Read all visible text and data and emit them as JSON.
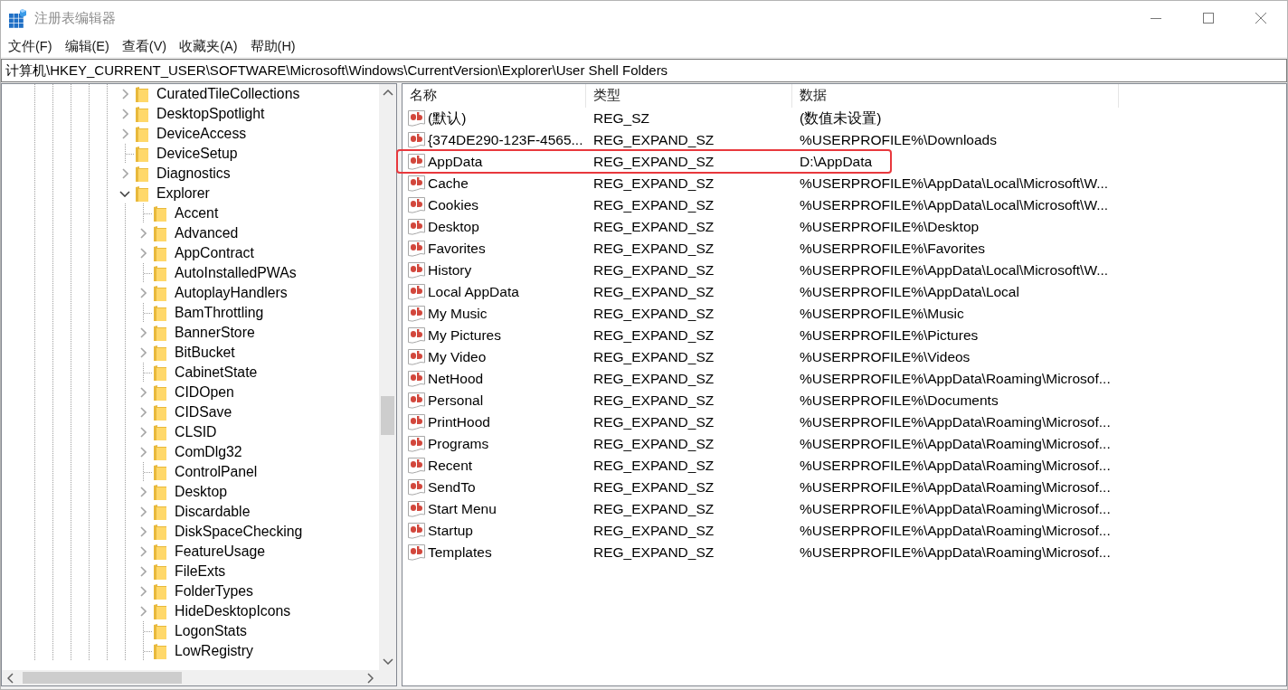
{
  "window": {
    "title": "注册表编辑器"
  },
  "menu": [
    "文件(F)",
    "编辑(E)",
    "查看(V)",
    "收藏夹(A)",
    "帮助(H)"
  ],
  "address_bar": {
    "value": "计算机\\HKEY_CURRENT_USER\\SOFTWARE\\Microsoft\\Windows\\CurrentVersion\\Explorer\\User Shell Folders"
  },
  "tree": {
    "items": [
      {
        "label": "CuratedTileCollections",
        "expandable": true,
        "expanded": false
      },
      {
        "label": "DesktopSpotlight",
        "expandable": true,
        "expanded": false
      },
      {
        "label": "DeviceAccess",
        "expandable": true,
        "expanded": false
      },
      {
        "label": "DeviceSetup",
        "expandable": false
      },
      {
        "label": "Diagnostics",
        "expandable": true,
        "expanded": false
      },
      {
        "label": "Explorer",
        "expandable": true,
        "expanded": true,
        "children": [
          {
            "label": "Accent",
            "expandable": false
          },
          {
            "label": "Advanced",
            "expandable": true,
            "expanded": false
          },
          {
            "label": "AppContract",
            "expandable": true,
            "expanded": false
          },
          {
            "label": "AutoInstalledPWAs",
            "expandable": false
          },
          {
            "label": "AutoplayHandlers",
            "expandable": true,
            "expanded": false
          },
          {
            "label": "BamThrottling",
            "expandable": false
          },
          {
            "label": "BannerStore",
            "expandable": true,
            "expanded": false
          },
          {
            "label": "BitBucket",
            "expandable": true,
            "expanded": false
          },
          {
            "label": "CabinetState",
            "expandable": false
          },
          {
            "label": "CIDOpen",
            "expandable": true,
            "expanded": false
          },
          {
            "label": "CIDSave",
            "expandable": true,
            "expanded": false
          },
          {
            "label": "CLSID",
            "expandable": true,
            "expanded": false
          },
          {
            "label": "ComDlg32",
            "expandable": true,
            "expanded": false
          },
          {
            "label": "ControlPanel",
            "expandable": false
          },
          {
            "label": "Desktop",
            "expandable": true,
            "expanded": false
          },
          {
            "label": "Discardable",
            "expandable": true,
            "expanded": false
          },
          {
            "label": "DiskSpaceChecking",
            "expandable": true,
            "expanded": false
          },
          {
            "label": "FeatureUsage",
            "expandable": true,
            "expanded": false
          },
          {
            "label": "FileExts",
            "expandable": true,
            "expanded": false
          },
          {
            "label": "FolderTypes",
            "expandable": true,
            "expanded": false
          },
          {
            "label": "HideDesktopIcons",
            "expandable": true,
            "expanded": false
          },
          {
            "label": "LogonStats",
            "expandable": false
          },
          {
            "label": "LowRegistry",
            "expandable": false
          }
        ]
      }
    ]
  },
  "values": {
    "columns": [
      "名称",
      "类型",
      "数据"
    ],
    "rows": [
      {
        "name": "(默认)",
        "type": "REG_SZ",
        "data": "(数值未设置)",
        "highlighted": false
      },
      {
        "name": "{374DE290-123F-4565...",
        "type": "REG_EXPAND_SZ",
        "data": "%USERPROFILE%\\Downloads",
        "highlighted": false
      },
      {
        "name": "AppData",
        "type": "REG_EXPAND_SZ",
        "data": "D:\\AppData",
        "highlighted": true
      },
      {
        "name": "Cache",
        "type": "REG_EXPAND_SZ",
        "data": "%USERPROFILE%\\AppData\\Local\\Microsoft\\W...",
        "highlighted": false
      },
      {
        "name": "Cookies",
        "type": "REG_EXPAND_SZ",
        "data": "%USERPROFILE%\\AppData\\Local\\Microsoft\\W...",
        "highlighted": false
      },
      {
        "name": "Desktop",
        "type": "REG_EXPAND_SZ",
        "data": "%USERPROFILE%\\Desktop",
        "highlighted": false
      },
      {
        "name": "Favorites",
        "type": "REG_EXPAND_SZ",
        "data": "%USERPROFILE%\\Favorites",
        "highlighted": false
      },
      {
        "name": "History",
        "type": "REG_EXPAND_SZ",
        "data": "%USERPROFILE%\\AppData\\Local\\Microsoft\\W...",
        "highlighted": false
      },
      {
        "name": "Local AppData",
        "type": "REG_EXPAND_SZ",
        "data": "%USERPROFILE%\\AppData\\Local",
        "highlighted": false
      },
      {
        "name": "My Music",
        "type": "REG_EXPAND_SZ",
        "data": "%USERPROFILE%\\Music",
        "highlighted": false
      },
      {
        "name": "My Pictures",
        "type": "REG_EXPAND_SZ",
        "data": "%USERPROFILE%\\Pictures",
        "highlighted": false
      },
      {
        "name": "My Video",
        "type": "REG_EXPAND_SZ",
        "data": "%USERPROFILE%\\Videos",
        "highlighted": false
      },
      {
        "name": "NetHood",
        "type": "REG_EXPAND_SZ",
        "data": "%USERPROFILE%\\AppData\\Roaming\\Microsof...",
        "highlighted": false
      },
      {
        "name": "Personal",
        "type": "REG_EXPAND_SZ",
        "data": "%USERPROFILE%\\Documents",
        "highlighted": false
      },
      {
        "name": "PrintHood",
        "type": "REG_EXPAND_SZ",
        "data": "%USERPROFILE%\\AppData\\Roaming\\Microsof...",
        "highlighted": false
      },
      {
        "name": "Programs",
        "type": "REG_EXPAND_SZ",
        "data": "%USERPROFILE%\\AppData\\Roaming\\Microsof...",
        "highlighted": false
      },
      {
        "name": "Recent",
        "type": "REG_EXPAND_SZ",
        "data": "%USERPROFILE%\\AppData\\Roaming\\Microsof...",
        "highlighted": false
      },
      {
        "name": "SendTo",
        "type": "REG_EXPAND_SZ",
        "data": "%USERPROFILE%\\AppData\\Roaming\\Microsof...",
        "highlighted": false
      },
      {
        "name": "Start Menu",
        "type": "REG_EXPAND_SZ",
        "data": "%USERPROFILE%\\AppData\\Roaming\\Microsof...",
        "highlighted": false
      },
      {
        "name": "Startup",
        "type": "REG_EXPAND_SZ",
        "data": "%USERPROFILE%\\AppData\\Roaming\\Microsof...",
        "highlighted": false
      },
      {
        "name": "Templates",
        "type": "REG_EXPAND_SZ",
        "data": "%USERPROFILE%\\AppData\\Roaming\\Microsof...",
        "highlighted": false
      }
    ]
  }
}
